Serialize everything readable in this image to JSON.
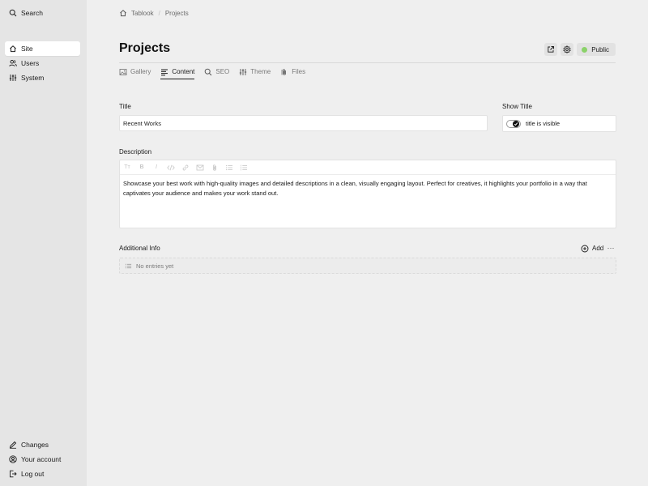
{
  "sidebar": {
    "search_label": "Search",
    "items": [
      {
        "label": "Site",
        "icon": "home-icon",
        "active": true
      },
      {
        "label": "Users",
        "icon": "users-icon"
      },
      {
        "label": "System",
        "icon": "sliders-icon"
      }
    ],
    "bottom_items": [
      {
        "label": "Changes",
        "icon": "pencil-icon"
      },
      {
        "label": "Your account",
        "icon": "user-circle-icon"
      },
      {
        "label": "Log out",
        "icon": "logout-icon"
      }
    ]
  },
  "breadcrumb": {
    "items": [
      "Tablook",
      "Projects"
    ],
    "separator": "/"
  },
  "page": {
    "title": "Projects",
    "status_label": "Public",
    "status_color": "#8bd26a"
  },
  "tabs": [
    {
      "label": "Gallery",
      "icon": "image-icon"
    },
    {
      "label": "Content",
      "icon": "text-align-icon",
      "active": true
    },
    {
      "label": "SEO",
      "icon": "search-icon"
    },
    {
      "label": "Theme",
      "icon": "sliders-icon"
    },
    {
      "label": "Files",
      "icon": "paperclip-icon"
    }
  ],
  "fields": {
    "title_label": "Title",
    "title_value": "Recent Works",
    "show_title_label": "Show Title",
    "show_title_text": "title is visible",
    "show_title_on": true,
    "description_label": "Description",
    "description_value": "Showcase your best work with high-quality images and detailed descriptions in a clean, visually engaging layout. Perfect for creatives, it highlights your portfolio in a way that captivates your audience and makes your work stand out."
  },
  "additional_info": {
    "title": "Additional Info",
    "add_label": "Add",
    "more_label": "⋯",
    "empty_text": "No entries yet"
  },
  "editor_toolbar": {
    "headings": "Tт",
    "bold": "B",
    "italic": "I"
  }
}
